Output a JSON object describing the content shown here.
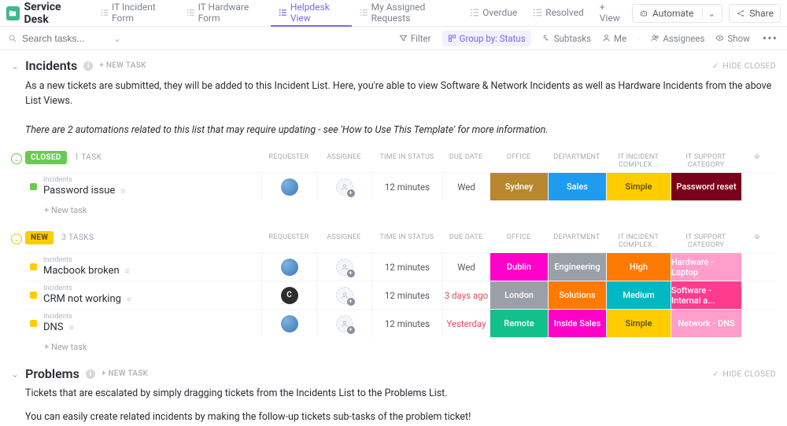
{
  "header": {
    "title": "Service Desk",
    "tabs": [
      "IT Incident Form",
      "IT Hardware Form",
      "Helpdesk View",
      "My Assigned Requests",
      "Overdue",
      "Resolved"
    ],
    "add_view": "+ View",
    "automate": "Automate",
    "share": "Share"
  },
  "toolbar": {
    "search_placeholder": "Search tasks...",
    "filter": "Filter",
    "groupby": "Group by: Status",
    "subtasks": "Subtasks",
    "me": "Me",
    "assignees": "Assignees",
    "show": "Show"
  },
  "incidents": {
    "title": "Incidents",
    "newtask": "+ NEW TASK",
    "hide_closed": "HIDE CLOSED",
    "desc1": "As a new tickets are submitted, they will be added to this Incident List. Here, you're able to view Software & Network Incidents as well as Hardware Incidents from the above List Views.",
    "desc2": "There are 2 automations related to this list that may require updating - see 'How to Use This Template' for more information.",
    "columns": [
      "REQUESTER",
      "ASSIGNEE",
      "TIME IN STATUS",
      "DUE DATE",
      "OFFICE",
      "DEPARTMENT",
      "IT INCIDENT COMPLEX...",
      "IT SUPPORT CATEGORY"
    ],
    "groups": [
      {
        "status": "CLOSED",
        "badge_class": "status-closed",
        "chev_class": "green",
        "sq": "sq-closed",
        "count": "1 TASK",
        "tasks": [
          {
            "parent": "Incidents",
            "title": "Password issue",
            "requester": "img",
            "time": "12 minutes",
            "due": "Wed",
            "due_red": false,
            "office": {
              "t": "Sydney",
              "c": "#b8872e"
            },
            "dept": {
              "t": "Sales",
              "c": "#1f9bf0"
            },
            "complex": {
              "t": "Simple",
              "c": "#ffcc00",
              "tc": "#5a4b00"
            },
            "cat": {
              "t": "Password reset",
              "c": "#7a0019"
            }
          }
        ]
      },
      {
        "status": "NEW",
        "badge_class": "status-new",
        "chev_class": "yellow",
        "sq": "sq-new",
        "count": "3 TASKS",
        "tasks": [
          {
            "parent": "Incidents",
            "title": "Macbook broken",
            "requester": "img",
            "time": "12 minutes",
            "due": "Wed",
            "due_red": false,
            "office": {
              "t": "Dublin",
              "c": "#ff00c8"
            },
            "dept": {
              "t": "Engineering",
              "c": "#9aa0a8"
            },
            "complex": {
              "t": "High",
              "c": "#ff7a00"
            },
            "cat": {
              "t": "Hardware - Laptop",
              "c": "#ff9ecb"
            }
          },
          {
            "parent": "Incidents",
            "title": "CRM not working",
            "requester": "C",
            "time": "12 minutes",
            "due": "3 days ago",
            "due_red": true,
            "office": {
              "t": "London",
              "c": "#9aa0a8"
            },
            "dept": {
              "t": "Solutions",
              "c": "#ff7a00"
            },
            "complex": {
              "t": "Medium",
              "c": "#00b8c4"
            },
            "cat": {
              "t": "Software - Internal a...",
              "c": "#ff3b8d"
            }
          },
          {
            "parent": "Incidents",
            "title": "DNS",
            "requester": "img",
            "time": "12 minutes",
            "due": "Yesterday",
            "due_red": true,
            "office": {
              "t": "Remote",
              "c": "#13c08b"
            },
            "dept": {
              "t": "Inside Sales",
              "c": "#ff00c8"
            },
            "complex": {
              "t": "Simple",
              "c": "#ffcc00",
              "tc": "#5a4b00"
            },
            "cat": {
              "t": "Network - DNS",
              "c": "#ff9ecb"
            }
          }
        ]
      }
    ],
    "newtask_row": "+ New task"
  },
  "problems": {
    "title": "Problems",
    "newtask": "+ NEW TASK",
    "hide_closed": "HIDE CLOSED",
    "desc1": "Tickets that are escalated by simply dragging tickets from the Incidents List to the Problems List.",
    "desc2": "You can easily create related incidents by making the follow-up tickets sub-tasks of the problem ticket!"
  }
}
